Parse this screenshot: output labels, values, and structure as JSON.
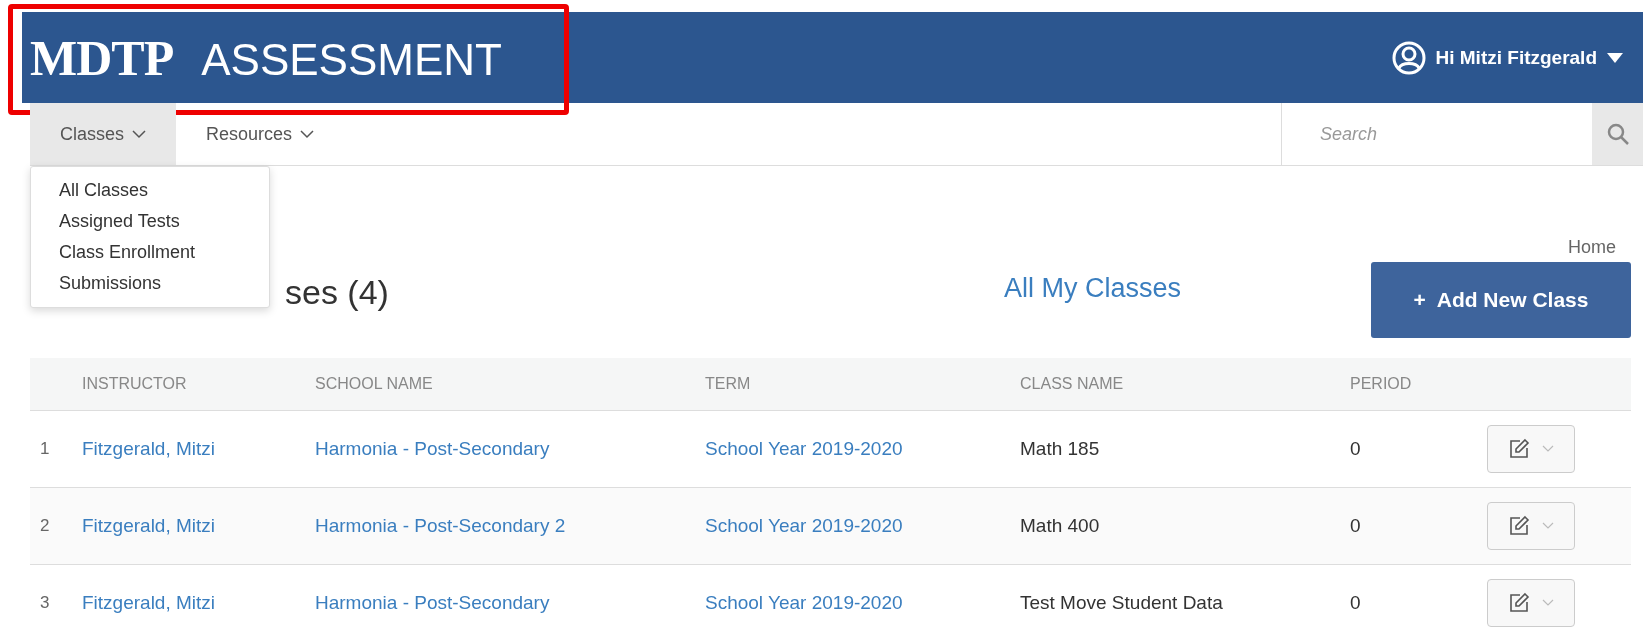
{
  "header": {
    "logo_mark": "MDTP",
    "logo_text": "ASSESSMENT",
    "user_greeting": "Hi Mitzi Fitzgerald"
  },
  "annotation": {
    "kind": "highlight_frame",
    "color": "#ee0000"
  },
  "nav": {
    "items": [
      {
        "label": "Classes",
        "expanded": true,
        "menu": [
          "All Classes",
          "Assigned Tests",
          "Class Enrollment",
          "Submissions"
        ]
      },
      {
        "label": "Resources",
        "expanded": false
      }
    ],
    "search": {
      "placeholder": "Search"
    }
  },
  "page": {
    "title": "ses (4)",
    "link": "All My Classes",
    "breadcrumb": "Home",
    "add_button": "+  Add New Class"
  },
  "table": {
    "columns": [
      "INSTRUCTOR",
      "SCHOOL NAME",
      "TERM",
      "CLASS NAME",
      "PERIOD"
    ],
    "rows": [
      {
        "index": "1",
        "instructor": "Fitzgerald, Mitzi",
        "school": "Harmonia - Post-Secondary",
        "term": "School Year 2019-2020",
        "class_name": "Math 185",
        "period": "0"
      },
      {
        "index": "2",
        "instructor": "Fitzgerald, Mitzi",
        "school": "Harmonia - Post-Secondary 2",
        "term": "School Year 2019-2020",
        "class_name": "Math 400",
        "period": "0"
      },
      {
        "index": "3",
        "instructor": "Fitzgerald, Mitzi",
        "school": "Harmonia - Post-Secondary",
        "term": "School Year 2019-2020",
        "class_name": "Test Move Student Data",
        "period": "0"
      }
    ]
  }
}
